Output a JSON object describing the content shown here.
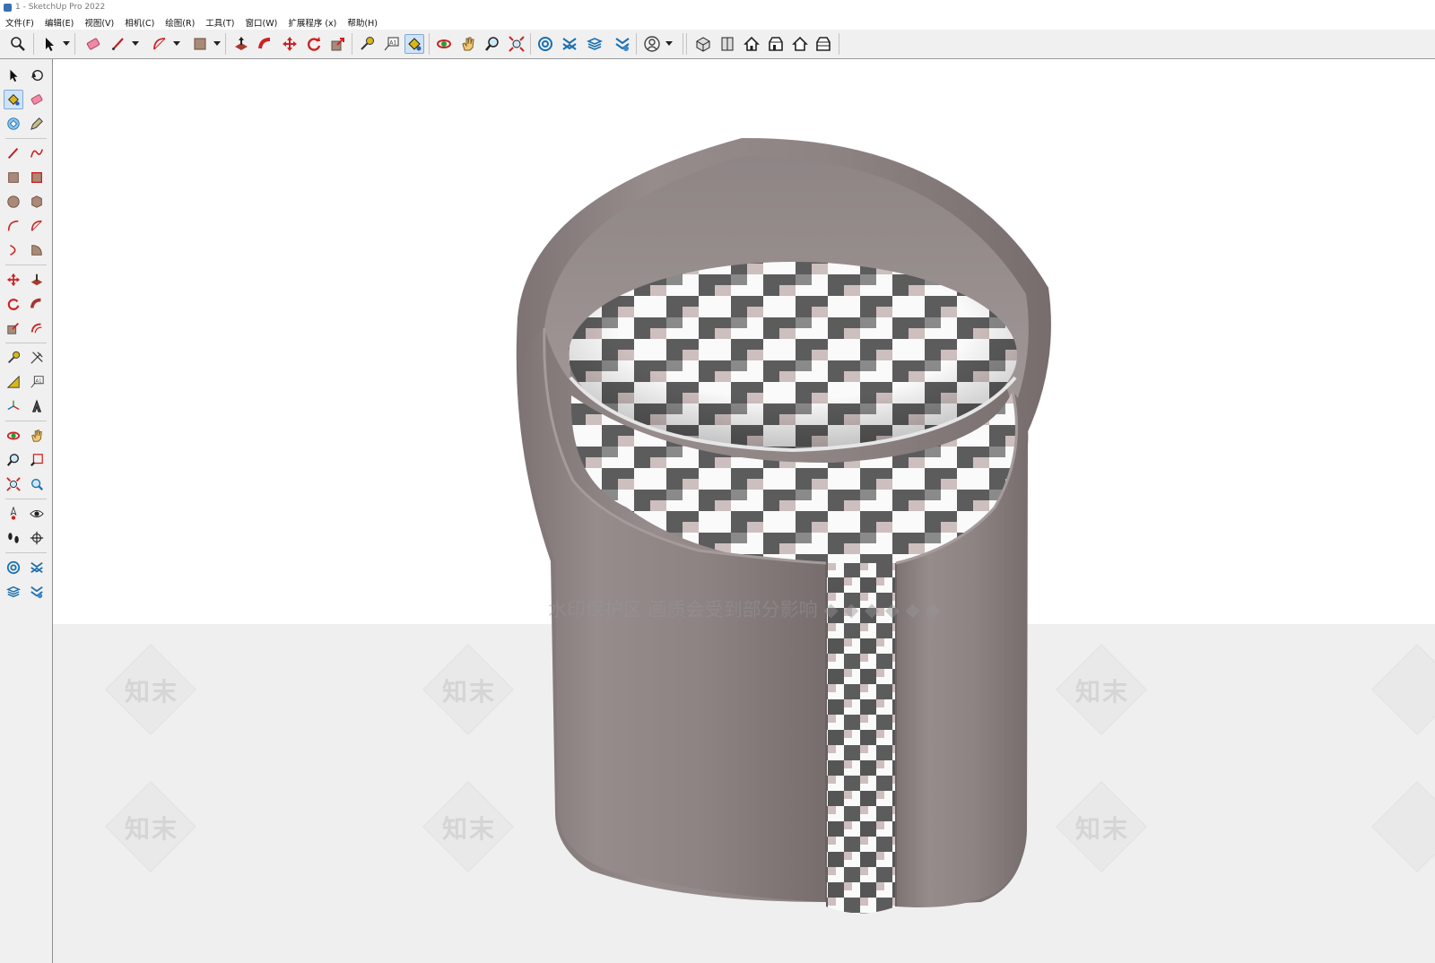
{
  "window": {
    "title": "1 - SketchUp Pro 2022"
  },
  "menu": [
    "文件(F)",
    "编辑(E)",
    "视图(V)",
    "相机(C)",
    "绘图(R)",
    "工具(T)",
    "窗口(W)",
    "扩展程序 (x)",
    "帮助(H)"
  ],
  "toolbar": {
    "icons": [
      "zoom-window-icon",
      "select-icon",
      "eraser-icon",
      "line-icon",
      "arc-icon",
      "rectangle-icon",
      "push-pull-icon",
      "follow-me-icon",
      "move-icon",
      "rotate-icon",
      "scale-icon",
      "tape-measure-icon",
      "text-icon",
      "paint-bucket-icon",
      "orbit-icon",
      "pan-icon",
      "zoom-icon",
      "zoom-extents-icon",
      "warehouse-icon",
      "extension-warehouse-icon",
      "layout-icon",
      "sketchup-tag-icon",
      "account-icon",
      "iso-view-icon",
      "top-view-icon",
      "front-view-icon",
      "right-view-icon",
      "back-view-icon",
      "left-view-icon"
    ],
    "active": "paint-bucket-icon"
  },
  "left_toolbar": {
    "icons": [
      "select-icon",
      "make-component-icon",
      "paint-bucket-icon",
      "eraser-icon",
      "lasso-select-icon",
      "tag-icon",
      "line-icon",
      "freehand-icon",
      "rectangle-icon",
      "rotated-rectangle-icon",
      "circle-icon",
      "polygon-icon",
      "arc-icon",
      "two-point-arc-icon",
      "three-point-arc-icon",
      "pie-icon",
      "move-icon",
      "push-pull-icon",
      "rotate-icon",
      "follow-me-icon",
      "scale-icon",
      "offset-icon",
      "tape-measure-icon",
      "dimension-icon",
      "protractor-icon",
      "text-icon",
      "axes-icon",
      "3d-text-icon",
      "orbit-icon",
      "pan-icon",
      "zoom-icon",
      "zoom-window-icon",
      "zoom-extents-icon",
      "previous-view-icon",
      "position-camera-icon",
      "look-around-icon",
      "walk-icon",
      "section-plane-icon",
      "warehouse-icon",
      "extension-warehouse-icon",
      "layout-icon",
      "extension-manager-icon"
    ],
    "active": "paint-bucket-icon"
  },
  "viewport": {
    "watermark_banner": "水印保护区  画质会受到部分影响  ◆ ◆ ◆ ◆ ◆ ◆",
    "watermark_logo": "知末"
  },
  "colors": {
    "fabric": "#8a8080",
    "fabric_light": "#9d9393",
    "check_dark": "#5c5c5c",
    "check_pink": "#cdbfbe",
    "check_white": "#fafafa"
  }
}
